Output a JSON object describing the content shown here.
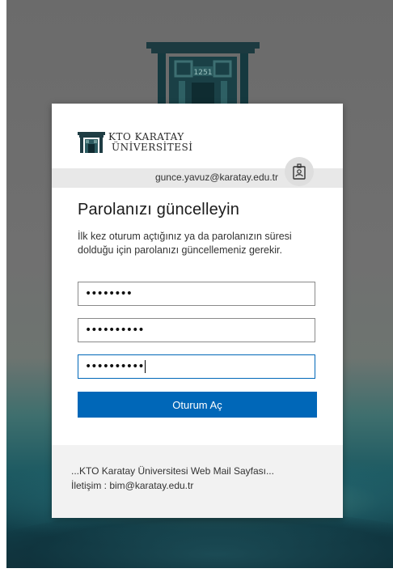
{
  "brand": {
    "emblem_icon": "karatay-gate-emblem-icon",
    "logo_icon": "karatay-gate-logo-icon",
    "logo_line1": "KTO KARATAY",
    "logo_line2": "ÜNİVERSİTESİ"
  },
  "account": {
    "email": "gunce.yavuz@karatay.edu.tr",
    "avatar_icon": "id-badge-icon"
  },
  "form": {
    "title": "Parolanızı güncelleyin",
    "description": "İlk kez oturum açtığınız ya da parolanızın süresi dolduğu için parolanızı güncellemeniz gerekir.",
    "fields": [
      {
        "value": "••••••••"
      },
      {
        "value": "••••••••••"
      },
      {
        "value": "••••••••••"
      }
    ],
    "submit_label": "Oturum Aç"
  },
  "footer": {
    "line1": "...KTO Karatay Üniversitesi Web Mail Sayfası...",
    "line2": "İletişim : bim@karatay.edu.tr"
  },
  "colors": {
    "accent": "#0067b8",
    "background_dark_teal": "#113e48",
    "background_gray": "#6b6b6b",
    "emblem": "#15393f"
  }
}
